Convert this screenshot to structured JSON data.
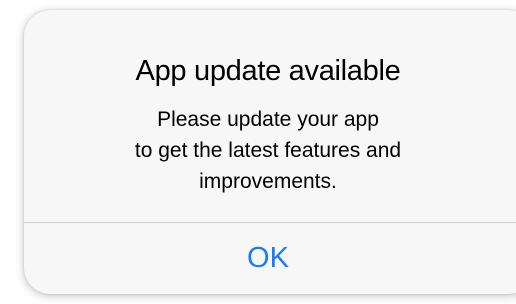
{
  "dialog": {
    "title": "App update available",
    "message_lines": [
      "Please update your app",
      "to get the latest features and",
      "improvements."
    ],
    "ok_label": "OK"
  },
  "colors": {
    "dialog_background": "#f7f7f7",
    "accent": "#1a7cf2",
    "divider": "#d0d0d4"
  }
}
